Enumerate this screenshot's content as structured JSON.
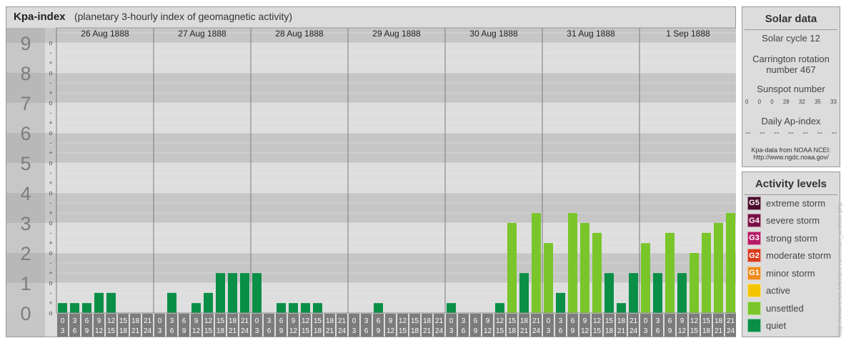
{
  "header": {
    "title": "Kpa-index",
    "subtitle": "(planetary 3-hourly index of geomagnetic activity)"
  },
  "chart_data": {
    "type": "bar",
    "title": "Kpa-index",
    "subtitle": "(planetary 3-hourly index of geomagnetic activity)",
    "ylim": [
      0,
      9
    ],
    "y_ticks": [
      "0",
      "1",
      "2",
      "3",
      "4",
      "5",
      "6",
      "7",
      "8",
      "9"
    ],
    "minor_marks": [
      "-",
      "o",
      "+"
    ],
    "days": [
      "26 Aug 1888",
      "27 Aug 1888",
      "28 Aug 1888",
      "29 Aug 1888",
      "30 Aug 1888",
      "31 Aug 1888",
      "1 Sep 1888"
    ],
    "interval_starts": [
      "0",
      "3",
      "6",
      "9",
      "12",
      "15",
      "18",
      "21"
    ],
    "interval_ends": [
      "3",
      "6",
      "9",
      "12",
      "15",
      "18",
      "21",
      "24"
    ],
    "series": [
      {
        "values": [
          0.33,
          0.33,
          0.33,
          0.67,
          0.67,
          0,
          0,
          0,
          0,
          0.67,
          0,
          0.33,
          0.67,
          1.33,
          1.33,
          1.33,
          1.33,
          0,
          0.33,
          0.33,
          0.33,
          0.33,
          0,
          0,
          0,
          0,
          0.33,
          0,
          0,
          0,
          0,
          0,
          0.33,
          0,
          0,
          0,
          0.33,
          3,
          1.33,
          3.33,
          2.33,
          0.67,
          3.33,
          3,
          2.67,
          1.33,
          0.33,
          1.33,
          2.33,
          1.33,
          2.67,
          1.33,
          2,
          2.67,
          3,
          3.33
        ]
      }
    ],
    "colors": {
      "quiet": "#0a8f47",
      "unsettled": "#7ac62a"
    },
    "grid": true,
    "legend": "right"
  },
  "solar": {
    "title": "Solar data",
    "cycle": "Solar cycle 12",
    "carrington_line1": "Carrington rotation",
    "carrington_line2": "number 467",
    "sunspot_label": "Sunspot number",
    "sunspot_values": [
      "0",
      "0",
      "0",
      "28",
      "32",
      "35",
      "33"
    ],
    "ap_label": "Daily Ap-index",
    "ap_values": [
      "--",
      "--",
      "--",
      "--",
      "--",
      "--",
      "--"
    ],
    "source_line1": "Kpa-data from NOAA NCEI:",
    "source_line2": "http://www.ngdc.noaa.gov/"
  },
  "activity": {
    "title": "Activity levels",
    "levels": [
      {
        "badge": "G5",
        "label": "extreme storm",
        "color": "#4a0c2c"
      },
      {
        "badge": "G4",
        "label": "severe storm",
        "color": "#7a1046"
      },
      {
        "badge": "G3",
        "label": "strong storm",
        "color": "#b61a66"
      },
      {
        "badge": "G2",
        "label": "moderate storm",
        "color": "#d93a1c"
      },
      {
        "badge": "G1",
        "label": "minor storm",
        "color": "#ee8a1e"
      },
      {
        "badge": "",
        "label": "active",
        "color": "#f5c400"
      },
      {
        "badge": "",
        "label": "unsettled",
        "color": "#7ac62a"
      },
      {
        "badge": "",
        "label": "quiet",
        "color": "#0a8f47"
      }
    ]
  },
  "credit": "http://www.tesis.lebedev.ru/en/sun_archive.php"
}
